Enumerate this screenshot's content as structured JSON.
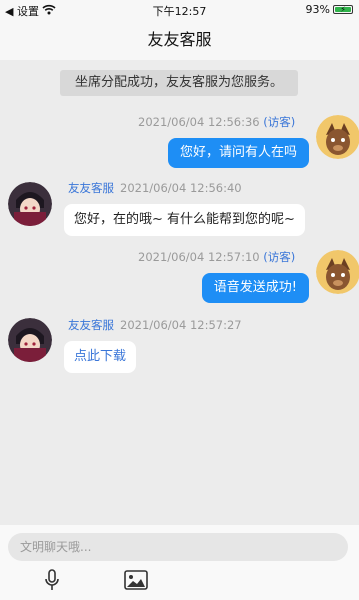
{
  "status_bar": {
    "back_label": "◀ 设置",
    "time": "下午12:57",
    "battery_pct": "93%"
  },
  "nav": {
    "title": "友友客服"
  },
  "chat": {
    "system_message": "坐席分配成功，友友客服为您服务。",
    "messages": [
      {
        "side": "right",
        "timestamp": "2021/06/04 12:56:36",
        "role_tag": "(访客)",
        "text": "您好，请问有人在吗"
      },
      {
        "side": "left",
        "sender": "友友客服",
        "timestamp": "2021/06/04 12:56:40",
        "text": "您好，在的哦~ 有什么能帮到您的呢~"
      },
      {
        "side": "right",
        "timestamp": "2021/06/04 12:57:10",
        "role_tag": "(访客)",
        "text": "语音发送成功!"
      },
      {
        "side": "left",
        "sender": "友友客服",
        "timestamp": "2021/06/04 12:57:27",
        "text": "点此下载"
      }
    ]
  },
  "input": {
    "placeholder": "文明聊天哦..."
  },
  "icons": {
    "mic": "microphone-icon",
    "image": "image-icon",
    "wifi": "wifi-icon",
    "battery": "battery-icon"
  },
  "colors": {
    "accent": "#1e8ef5",
    "link": "#3a76d8",
    "background": "#ececec"
  }
}
